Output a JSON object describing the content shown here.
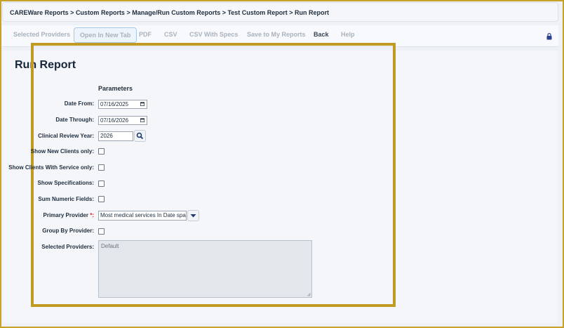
{
  "breadcrumb": "CAREWare Reports > Custom Reports > Manage/Run Custom Reports > Test Custom Report > Run Report",
  "menu": {
    "selected_providers": "Selected Providers",
    "open_in_new_tab": "Open In New Tab",
    "pdf": "PDF",
    "csv": "CSV",
    "csv_with_specs": "CSV With Specs",
    "save_to_my_reports": "Save to My Reports",
    "back": "Back",
    "help": "Help"
  },
  "page_title": "Run Report",
  "parameters": {
    "heading": "Parameters",
    "date_from_label": "Date From:",
    "date_from_value": "07/16/2025",
    "date_through_label": "Date Through:",
    "date_through_value": "07/16/2026",
    "clinical_review_year_label": "Clinical Review Year:",
    "clinical_review_year_value": "2026",
    "show_new_clients_label": "Show New Clients only:",
    "show_clients_with_service_label": "Show Clients With Service only:",
    "show_specifications_label": "Show Specifications:",
    "sum_numeric_fields_label": "Sum Numeric Fields:",
    "primary_provider_label": "Primary Provider",
    "primary_provider_required": "*:",
    "primary_provider_value": "Most medical services In Date span",
    "group_by_provider_label": "Group By Provider:",
    "selected_providers_label": "Selected Providers:",
    "selected_providers_value": "Default"
  },
  "icons": {
    "lock": "lock-icon",
    "search": "search-icon",
    "dropdown": "caret-down-icon",
    "calendar": "calendar-icon"
  },
  "colors": {
    "highlight_border": "#c09a22",
    "outer_border": "#c8a227",
    "required": "#d02020",
    "lock": "#2a3f8f"
  }
}
